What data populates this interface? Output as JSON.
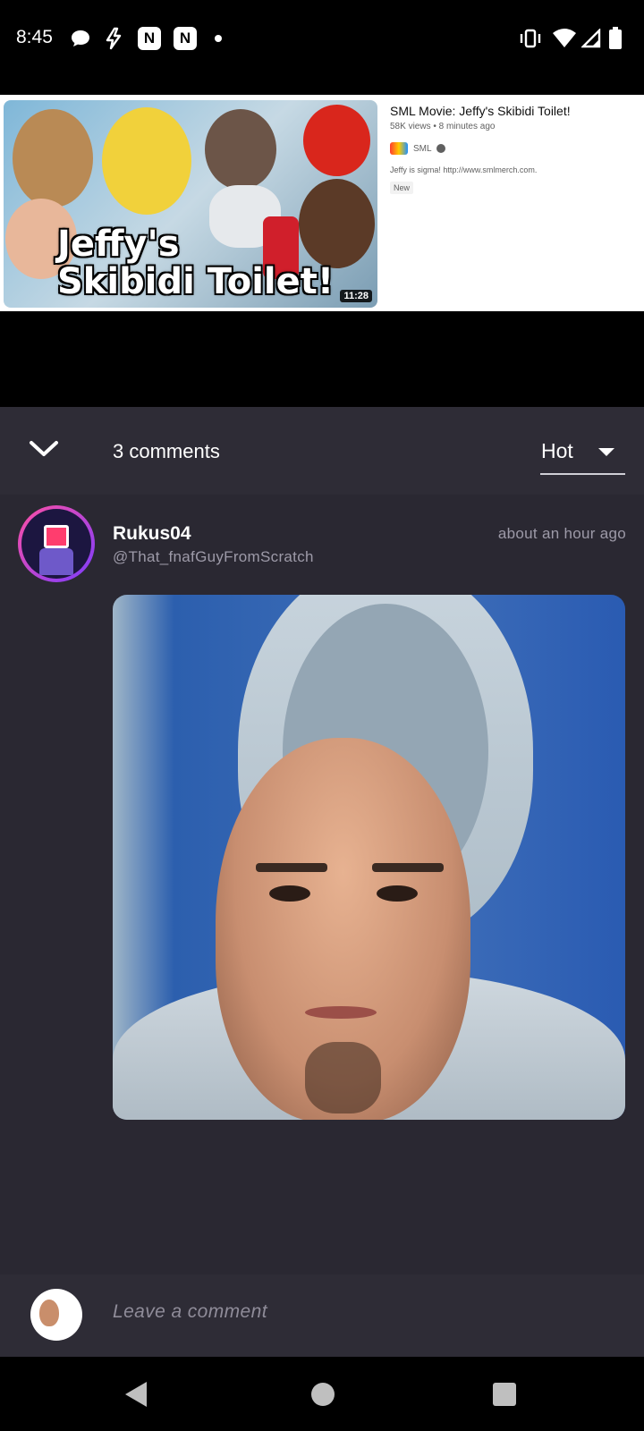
{
  "status_bar": {
    "time": "8:45",
    "icons": [
      "chat-bubble-icon",
      "bolt-icon",
      "app-n-icon",
      "app-n-icon",
      "dot-icon",
      "vibrate-icon",
      "wifi-icon",
      "signal-icon",
      "battery-icon"
    ]
  },
  "video": {
    "thumbnail_text_line1": "Jeffy's",
    "thumbnail_text_line2": "Skibidi Toilet!",
    "duration": "11:28",
    "title": "SML Movie: Jeffy's Skibidi Toilet!",
    "meta": "58K views • 8 minutes ago",
    "channel": "SML",
    "description": "Jeffy is sigma! http://www.smlmerch.com.",
    "badge": "New"
  },
  "comments_header": {
    "count_label": "3 comments",
    "sort_value": "Hot"
  },
  "comment": {
    "username": "Rukus04",
    "handle": "@That_fnafGuyFromScratch",
    "timestamp": "about an hour ago"
  },
  "input": {
    "placeholder": "Leave a comment"
  },
  "colors": {
    "sheet_bg": "#2a2832",
    "header_bg": "#2e2c36",
    "muted_text": "#9d9aa8",
    "avatar_ring": "#ff4fa3"
  }
}
